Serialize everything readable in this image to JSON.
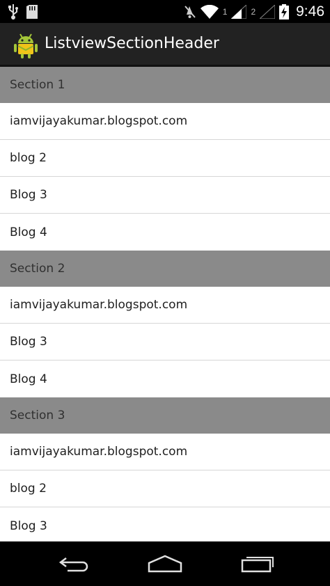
{
  "status_bar": {
    "icons": [
      "usb-icon",
      "sd-card-icon",
      "mute-icon",
      "wifi-icon",
      "signal-icon",
      "signal-icon",
      "battery-charging-icon"
    ],
    "sim1_label": "1",
    "sim2_label": "2",
    "time": "9:46"
  },
  "action_bar": {
    "app_icon": "android-icon",
    "title": "ListviewSectionHeader"
  },
  "sections": [
    {
      "title": "Section 1",
      "items": [
        "iamvijayakumar.blogspot.com",
        "blog 2",
        "Blog 3",
        "Blog 4"
      ]
    },
    {
      "title": "Section 2",
      "items": [
        "iamvijayakumar.blogspot.com",
        "Blog 3",
        "Blog 4"
      ]
    },
    {
      "title": "Section 3",
      "items": [
        "iamvijayakumar.blogspot.com",
        "blog 2",
        "Blog 3"
      ]
    }
  ],
  "nav_bar": {
    "icons": [
      "back-icon",
      "home-icon",
      "recent-apps-icon"
    ]
  },
  "colors": {
    "status_bar": "#000000",
    "action_bar": "#222222",
    "section_header": "#8a8a8a",
    "item_background": "#ffffff",
    "divider": "#d6d6d6"
  }
}
